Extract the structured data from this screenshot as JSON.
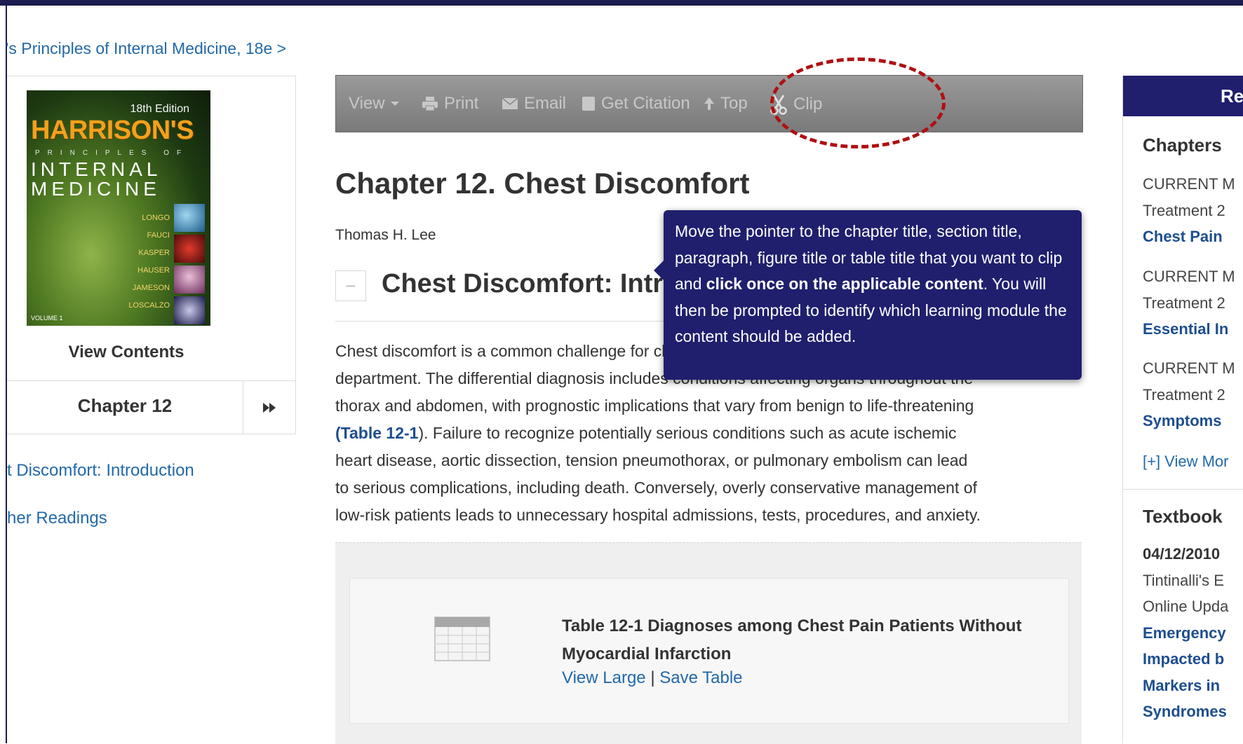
{
  "breadcrumb": {
    "book_link": "'s Principles of Internal Medicine, 18e >"
  },
  "book": {
    "cover": {
      "edition": "18th Edition",
      "brand": "HARRISON'S",
      "subtitle_line1": "PRINCIPLES OF",
      "subtitle_line2": "INTERNAL",
      "subtitle_line3": "MEDICINE",
      "authors": [
        "LONGO",
        "FAUCI",
        "KASPER",
        "HAUSER",
        "JAMESON",
        "LOSCALZO"
      ],
      "volume": "VOLUME 1"
    },
    "view_contents_label": "View Contents",
    "chapter_label": "Chapter 12",
    "next_icon": "fast-forward-icon"
  },
  "toc": {
    "items": [
      {
        "label": "t Discomfort: Introduction"
      },
      {
        "label": "her Readings"
      }
    ]
  },
  "toolbar": {
    "view_label": "View",
    "print_label": "Print",
    "email_label": "Email",
    "citation_label": "Get Citation",
    "top_label": "Top",
    "clip_label": "Clip",
    "highlight_color": "#b01010"
  },
  "article": {
    "title": "Chapter 12. Chest Discomfort",
    "author": "Thomas H. Lee",
    "collapse_symbol": "−",
    "section_title": "Chest Discomfort: Introduction",
    "paragraph_lines": [
      "Chest discomfort is a common challenge for clinicians in the office and emergency",
      "department. The differential diagnosis includes conditions affecting organs throughout the",
      "thorax and abdomen, with prognostic implications that vary from benign to life-threatening",
      "). Failure to recognize potentially serious conditions such as acute ischemic",
      "heart disease, aortic dissection, tension pneumothorax, or pulmonary embolism can lead",
      "to serious complications, including death. Conversely, overly conservative management of",
      "low-risk patients leads to unnecessary hospital admissions, tests, procedures, and anxiety."
    ],
    "table_ref": "(Table 12-1",
    "table": {
      "title": "Table 12-1 Diagnoses among Chest Pain Patients Without Myocardial Infarction",
      "view_large": "View Large",
      "separator": "|",
      "save_table": "Save Table"
    }
  },
  "tooltip": {
    "text_before": "Move the pointer to the chapter title, section title, paragraph, figure title or table title that you want to clip and ",
    "text_bold": "click once on the applicable content",
    "text_after": ". You will then be prompted to identify which learning module the content should be added.",
    "background": "#1f1f6e"
  },
  "related": {
    "header": "Re",
    "chapters_heading": "Chapters",
    "chapter_items": [
      {
        "line1": "CURRENT M",
        "line2": "Treatment 2",
        "title": "Chest Pain"
      },
      {
        "line1": "CURRENT M",
        "line2": "Treatment 2",
        "title": "Essential In"
      },
      {
        "line1": "CURRENT M",
        "line2": "Treatment 2",
        "title": "Symptoms"
      }
    ],
    "view_more": "[+] View Mor",
    "textbook_heading": "Textbook",
    "textbook_item": {
      "date": "04/12/2010",
      "line1": "Tintinalli's E",
      "line2": "Online Upda",
      "title_lines": [
        "Emergency",
        "Impacted b",
        "Markers in",
        "Syndromes"
      ]
    }
  }
}
